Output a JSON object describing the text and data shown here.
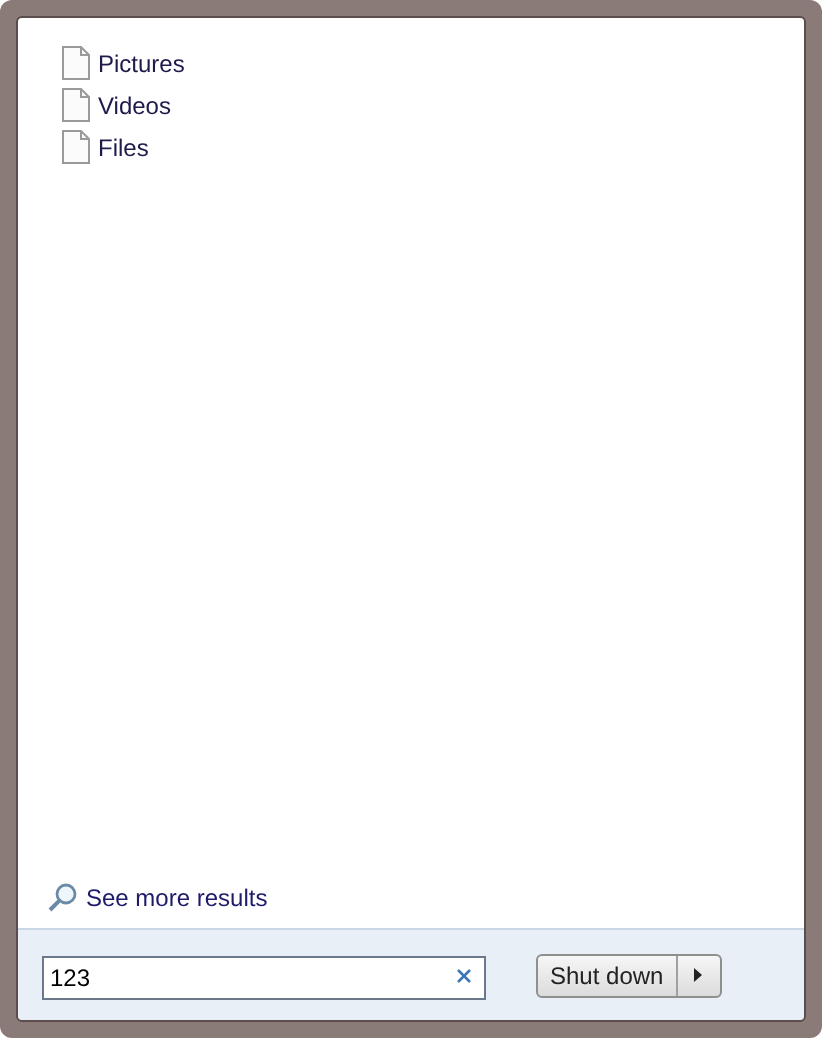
{
  "results": [
    {
      "label": "Pictures"
    },
    {
      "label": "Videos"
    },
    {
      "label": "Files"
    }
  ],
  "see_more": {
    "label": "See more results"
  },
  "search": {
    "value": "123"
  },
  "shutdown": {
    "label": "Shut down"
  }
}
